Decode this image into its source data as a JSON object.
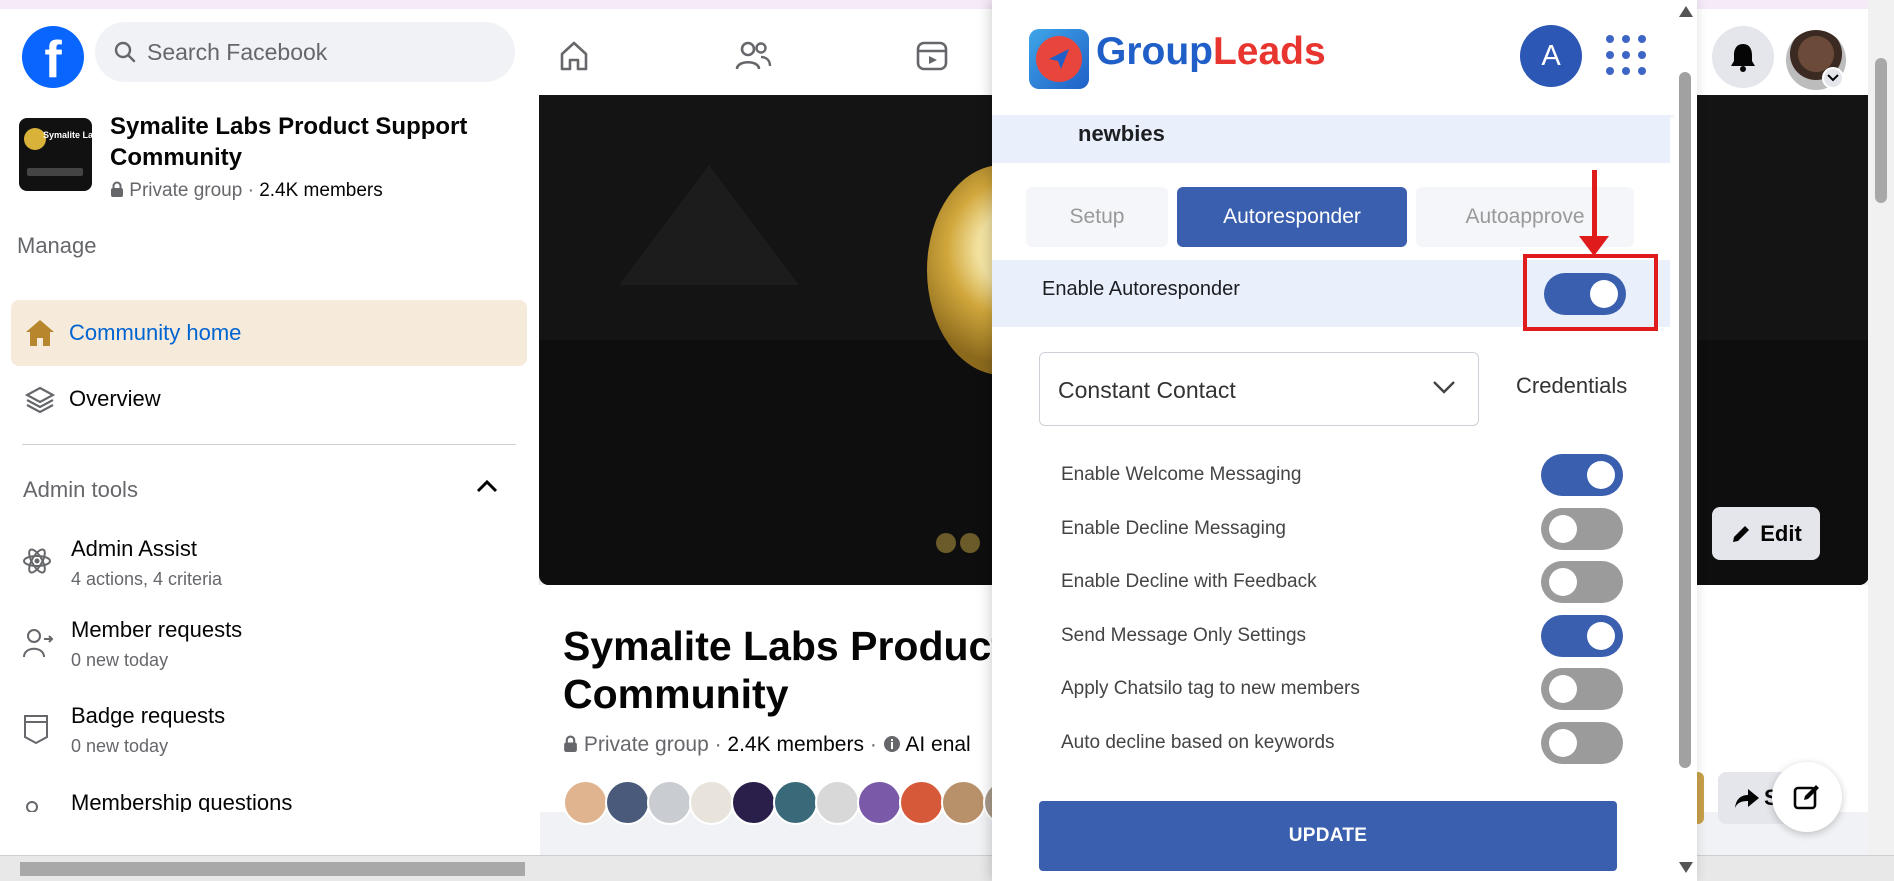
{
  "facebook": {
    "logo": "f",
    "search_placeholder": "Search Facebook"
  },
  "sidebar": {
    "group_name": "Symalite Labs Product Support Community",
    "thumb_label": "Symalite Labs",
    "privacy": "Private group",
    "members": "2.4K members",
    "manage_label": "Manage",
    "items": [
      {
        "label": "Community home",
        "icon": "home-icon",
        "active": true
      },
      {
        "label": "Overview",
        "icon": "layers-icon",
        "active": false
      }
    ],
    "admin_tools_label": "Admin tools",
    "tools": [
      {
        "title": "Admin Assist",
        "subtitle": "4 actions, 4 criteria",
        "icon": "atom-icon"
      },
      {
        "title": "Member requests",
        "subtitle": "0 new today",
        "icon": "person-arrow-icon"
      },
      {
        "title": "Badge requests",
        "subtitle": "0 new today",
        "icon": "badge-icon"
      },
      {
        "title": "Membership questions",
        "subtitle": "",
        "icon": "person-list-icon"
      }
    ]
  },
  "main": {
    "title_line1": "Symalite Labs Product",
    "title_line2": "Community",
    "privacy": "Private group",
    "members": "2.4K members",
    "extra": "AI enal",
    "edit_label": "Edit",
    "share_label": "S"
  },
  "extension": {
    "brand_part1": "Group",
    "brand_part2": "Leads",
    "avatar_letter": "A",
    "group_label": "newbies",
    "tabs": [
      {
        "label": "Setup",
        "active": false
      },
      {
        "label": "Autoresponder",
        "active": true
      },
      {
        "label": "Autoapprove",
        "active": false
      }
    ],
    "enable_autoresponder": {
      "label": "Enable Autoresponder",
      "on": true
    },
    "provider": "Constant Contact",
    "credentials_label": "Credentials",
    "options": [
      {
        "label": "Enable Welcome Messaging",
        "on": true
      },
      {
        "label": "Enable Decline Messaging",
        "on": false
      },
      {
        "label": "Enable Decline with Feedback",
        "on": false
      },
      {
        "label": "Send Message Only Settings",
        "on": true
      },
      {
        "label": "Apply Chatsilo tag to new members",
        "on": false
      },
      {
        "label": "Auto decline based on keywords",
        "on": false
      }
    ],
    "update_label": "UPDATE"
  },
  "colors": {
    "facebook_blue": "#0866ff",
    "extension_blue": "#3a5fae",
    "annotation_red": "#e01b1b",
    "active_nav_bg": "#f6eadb"
  }
}
